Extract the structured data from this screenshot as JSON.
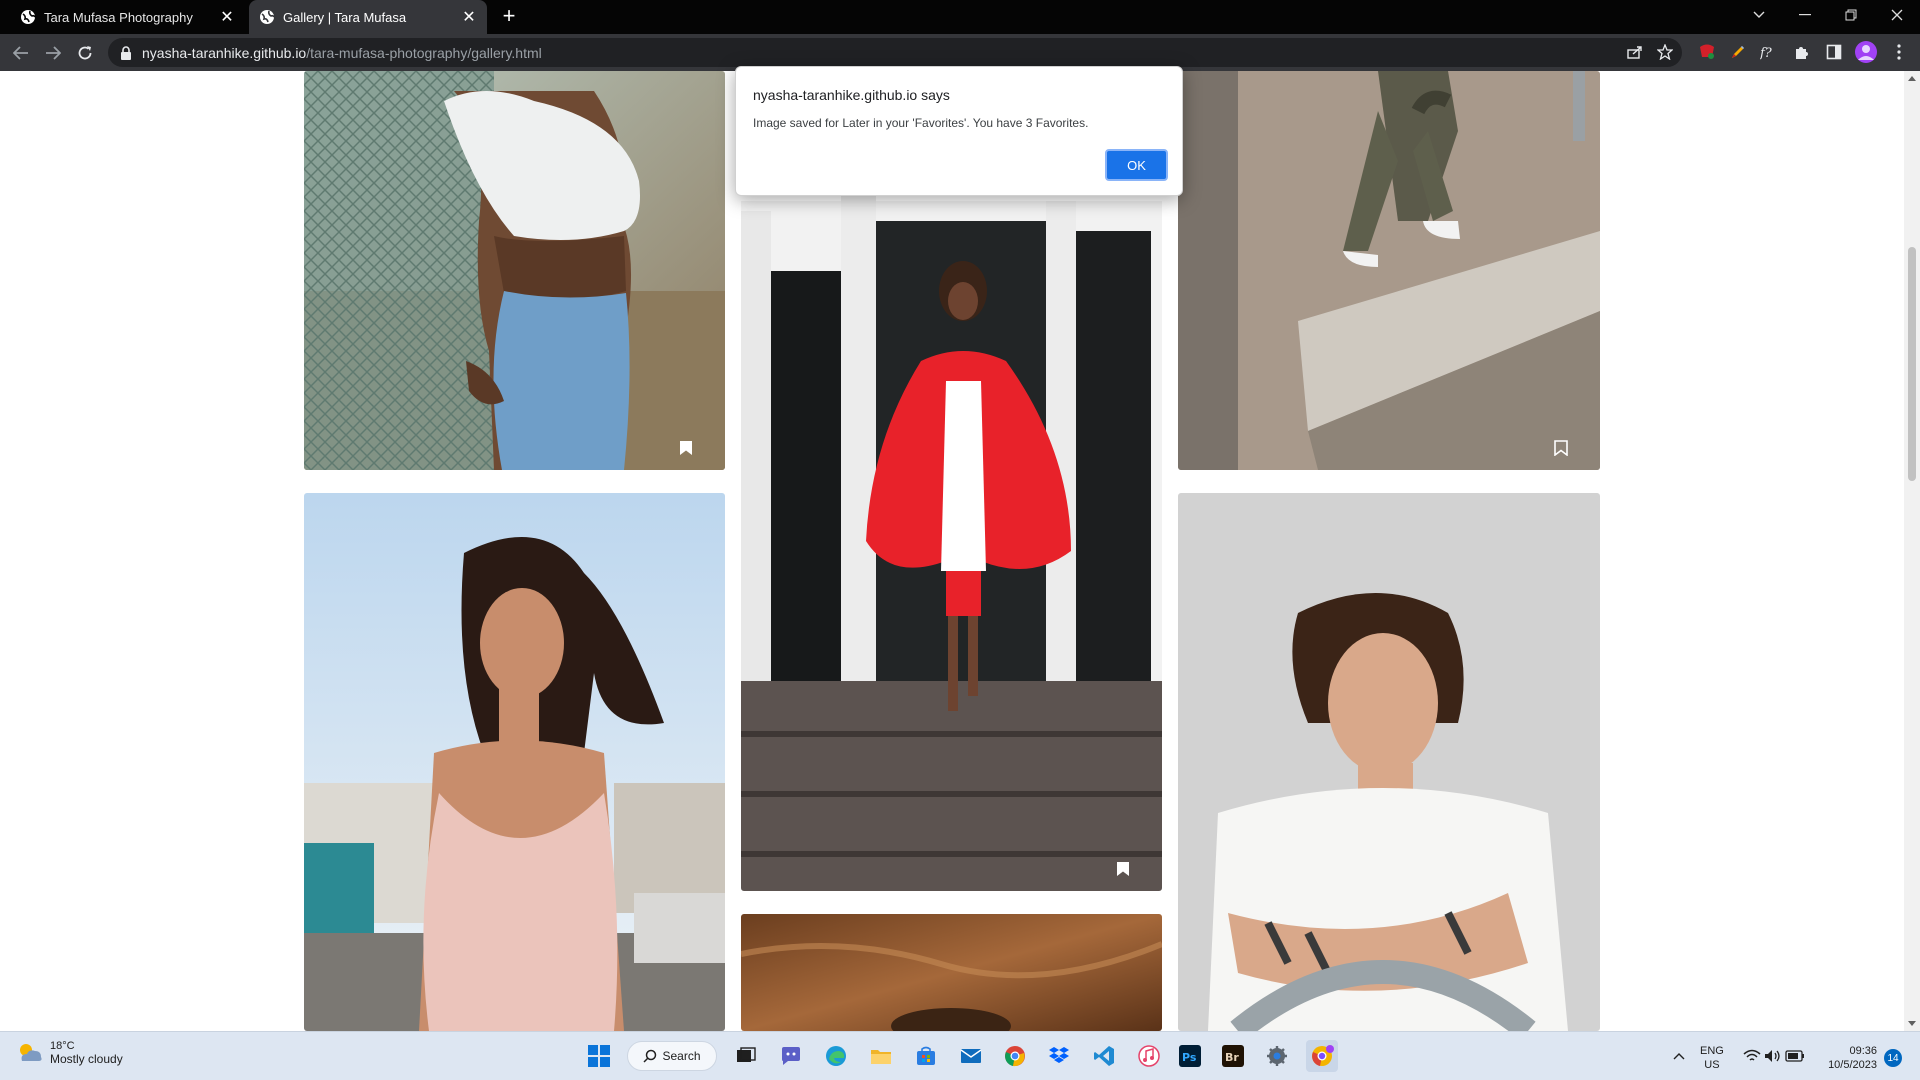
{
  "browser": {
    "tabs": [
      {
        "title": "Tara Mufasa Photography",
        "active": false
      },
      {
        "title": "Gallery | Tara Mufasa",
        "active": true
      }
    ],
    "url_host": "nyasha-taranhike.github.io",
    "url_path": "/tara-mufasa-photography/gallery.html"
  },
  "dialog": {
    "origin": "nyasha-taranhike.github.io says",
    "message": "Image saved for Later in your 'Favorites'. You have 3 Favorites.",
    "ok_label": "OK"
  },
  "gallery": {
    "photos": [
      {
        "name": "woman-fence-white-top",
        "column": 1
      },
      {
        "name": "woman-red-gown-stairs",
        "column": 2
      },
      {
        "name": "person-camo-pants-sneakers",
        "column": 3
      },
      {
        "name": "woman-pink-dress-wind",
        "column": 1
      },
      {
        "name": "man-white-shirt-smoking",
        "column": 3
      },
      {
        "name": "brown-outdoor-photo",
        "column": 2
      }
    ]
  },
  "taskbar": {
    "weather_temp": "18°C",
    "weather_condition": "Mostly cloudy",
    "search_label": "Search",
    "lang_line1": "ENG",
    "lang_line2": "US",
    "time": "09:36",
    "date": "10/5/2023",
    "notification_count": "14"
  },
  "colors": {
    "accent": "#1a73e8",
    "tabstrip": "#050505",
    "toolbar": "#35363a",
    "taskbar": "#dde6f2"
  }
}
